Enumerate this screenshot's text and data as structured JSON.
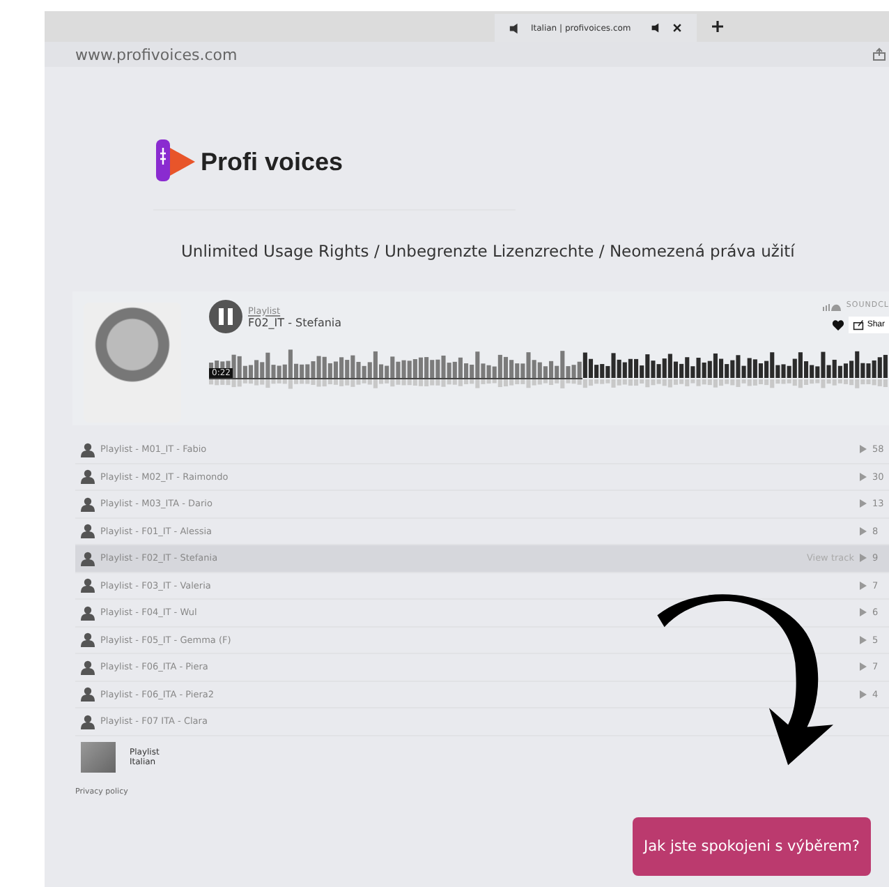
{
  "browser": {
    "tab_title": "Italian | profivoices.com",
    "url": "www.profivoices.com"
  },
  "logo": {
    "text": "Profi voices"
  },
  "headline": "Unlimited Usage Rights / Unbegrenzte Lizenzrechte / Neomezená práva užití",
  "player": {
    "playlist_label": "Playlist",
    "track_title": "F02_IT - Stefania",
    "brand": "SOUNDCL",
    "share_label": "Shar",
    "time": "0:22",
    "playing": true,
    "level": 0.55
  },
  "tracks": [
    {
      "title": "Playlist - M01_IT - Fabio",
      "plays": "58",
      "selected": false
    },
    {
      "title": "Playlist - M02_IT - Raimondo",
      "plays": "30",
      "selected": false
    },
    {
      "title": "Playlist - M03_ITA - Dario",
      "plays": "13",
      "selected": false
    },
    {
      "title": "Playlist - F01_IT - Alessia",
      "plays": "8",
      "selected": false
    },
    {
      "title": "Playlist - F02_IT - Stefania",
      "plays": "9",
      "selected": true,
      "view_label": "View track"
    },
    {
      "title": "Playlist - F03_IT - Valeria",
      "plays": "7",
      "selected": false
    },
    {
      "title": "Playlist - F04_IT - Wul",
      "plays": "6",
      "selected": false
    },
    {
      "title": "Playlist - F05_IT - Gemma (F)",
      "plays": "5",
      "selected": false
    },
    {
      "title": "Playlist - F06_ITA - Piera",
      "plays": "7",
      "selected": false
    },
    {
      "title": "Playlist - F06_ITA - Piera2",
      "plays": "4",
      "selected": false
    },
    {
      "title": "Playlist - F07 ITA - Clara",
      "selected": false
    }
  ],
  "footer": {
    "playlist_label": "Playlist",
    "playlist_name": "Italian",
    "privacy": "Privacy policy"
  },
  "feedback_button": "Jak jste spokojeni s výběrem?"
}
